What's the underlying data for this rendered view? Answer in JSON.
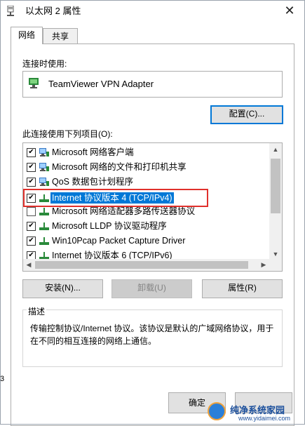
{
  "window": {
    "title": "以太网 2 属性",
    "close_label": "✕"
  },
  "tabs": [
    {
      "label": "网络",
      "active": true
    },
    {
      "label": "共享",
      "active": false
    }
  ],
  "connection": {
    "label": "连接时使用:",
    "adapter": "TeamViewer VPN Adapter",
    "configure_label": "配置(C)..."
  },
  "items": {
    "label": "此连接使用下列项目(O):",
    "list": [
      {
        "label": "Microsoft 网络客户端",
        "checked": true,
        "icon": "network-client-icon"
      },
      {
        "label": "Microsoft 网络的文件和打印机共享",
        "checked": true,
        "icon": "file-printer-sharing-icon"
      },
      {
        "label": "QoS 数据包计划程序",
        "checked": true,
        "icon": "qos-packet-scheduler-icon"
      },
      {
        "label": "Internet 协议版本 4 (TCP/IPv4)",
        "checked": true,
        "selected": true,
        "icon": "protocol-icon"
      },
      {
        "label": "Microsoft 网络适配器多路传送器协议",
        "checked": false,
        "icon": "protocol-icon"
      },
      {
        "label": "Microsoft LLDP 协议驱动程序",
        "checked": true,
        "icon": "protocol-icon"
      },
      {
        "label": "Win10Pcap Packet Capture Driver",
        "checked": true,
        "icon": "protocol-icon"
      },
      {
        "label": "Internet 协议版本 6 (TCP/IPv6)",
        "checked": true,
        "icon": "protocol-icon"
      }
    ]
  },
  "buttons": {
    "install": "安装(N)...",
    "uninstall": "卸载(U)",
    "properties": "属性(R)",
    "ok": "确定",
    "cancel": ""
  },
  "description": {
    "title": "描述",
    "text": "传输控制协议/Internet 协议。该协议是默认的广域网络协议，用于在不同的相互连接的网络上通信。"
  },
  "stray_digit": "3",
  "watermark": {
    "title": "纯净系统家园",
    "url": "www.yidaimei.com"
  },
  "colors": {
    "selection": "#0078d7",
    "highlight_box": "#e0302c",
    "button_face": "#e1e1e1"
  }
}
